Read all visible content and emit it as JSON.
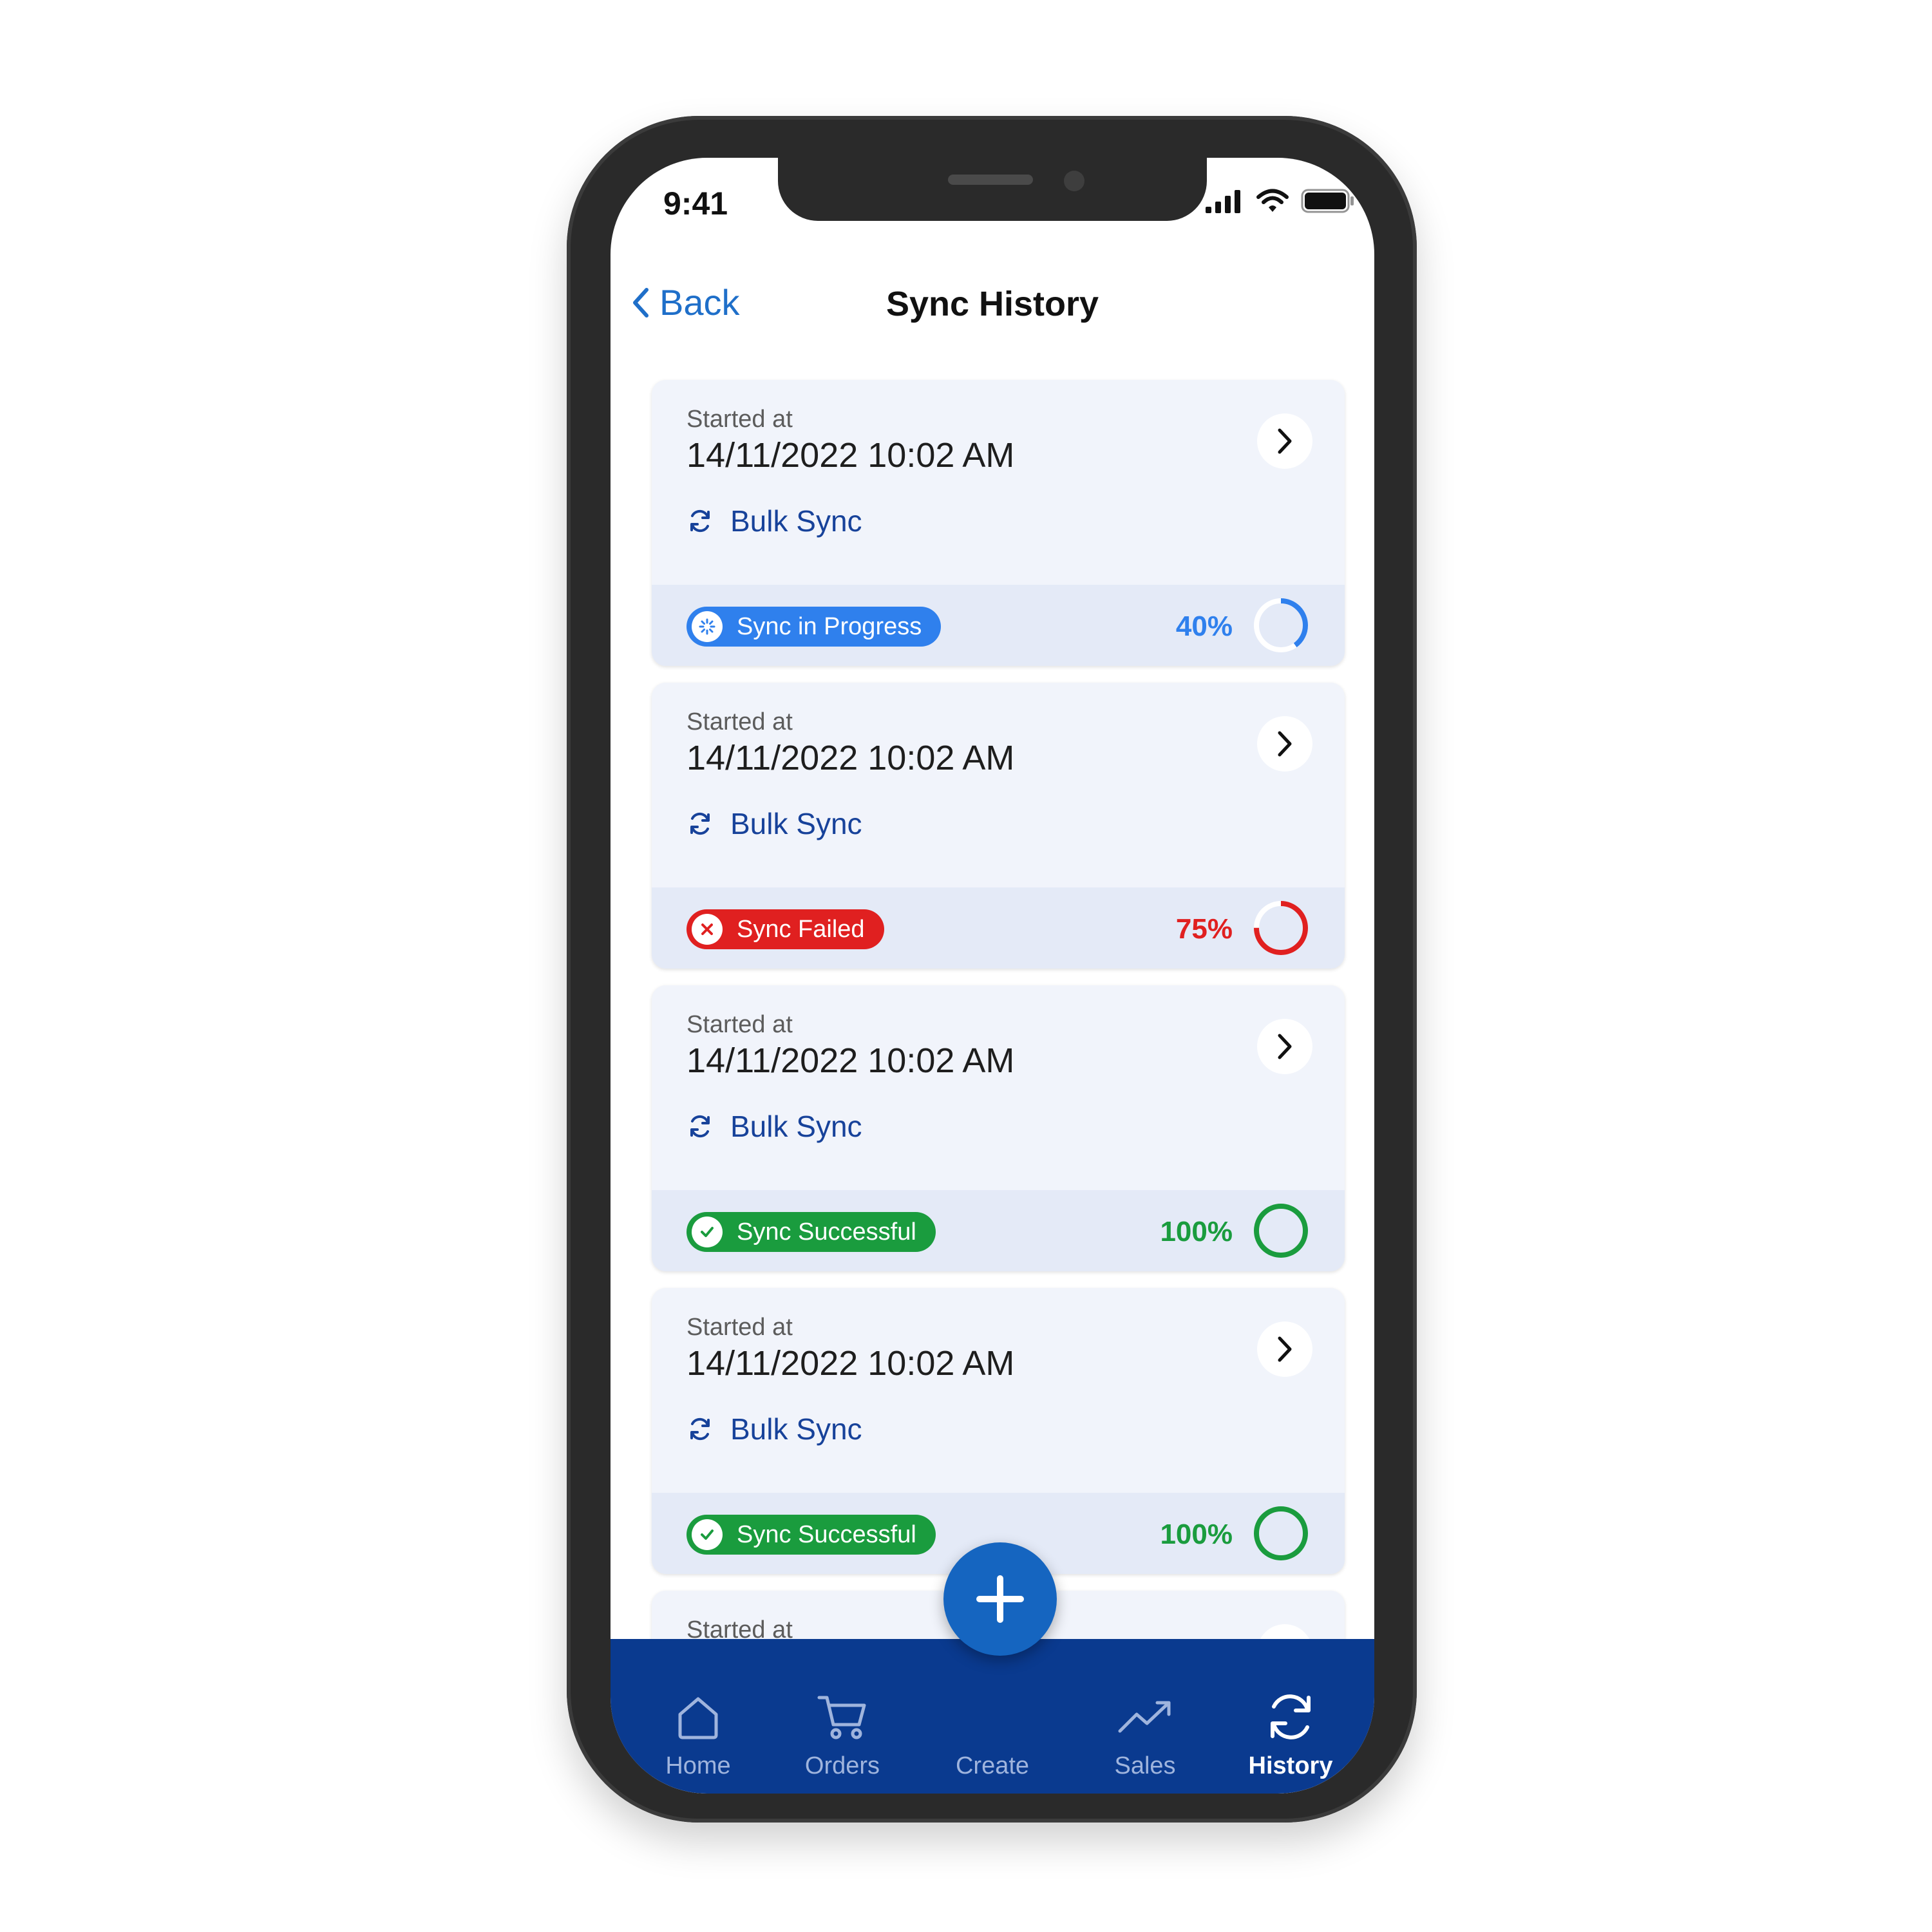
{
  "status_bar": {
    "time": "9:41"
  },
  "header": {
    "back_label": "Back",
    "title": "Sync History"
  },
  "colors": {
    "brand_blue": "#0a3a8f",
    "link_blue": "#1f6fc9",
    "progress_blue": "#2f80ed",
    "failed_red": "#e02020",
    "success_green": "#1a9c3e"
  },
  "cards": [
    {
      "started_label": "Started at",
      "started_value": "14/11/2022 10:02 AM",
      "sync_type": "Bulk Sync",
      "status": "Sync in Progress",
      "status_kind": "progress",
      "percent_label": "40%",
      "progress": 0.4
    },
    {
      "started_label": "Started at",
      "started_value": "14/11/2022 10:02 AM",
      "sync_type": "Bulk Sync",
      "status": "Sync Failed",
      "status_kind": "failed",
      "percent_label": "75%",
      "progress": 0.75
    },
    {
      "started_label": "Started at",
      "started_value": "14/11/2022 10:02 AM",
      "sync_type": "Bulk Sync",
      "status": "Sync Successful",
      "status_kind": "success",
      "percent_label": "100%",
      "progress": 1.0
    },
    {
      "started_label": "Started at",
      "started_value": "14/11/2022 10:02 AM",
      "sync_type": "Bulk Sync",
      "status": "Sync Successful",
      "status_kind": "success",
      "percent_label": "100%",
      "progress": 1.0
    },
    {
      "started_label": "Started at"
    }
  ],
  "tab_bar": {
    "items": [
      {
        "label": "Home",
        "icon": "home-icon"
      },
      {
        "label": "Orders",
        "icon": "cart-icon"
      },
      {
        "label": "Create",
        "icon": "plus-icon"
      },
      {
        "label": "Sales",
        "icon": "trend-icon"
      },
      {
        "label": "History",
        "icon": "sync-icon",
        "active": true
      }
    ]
  }
}
